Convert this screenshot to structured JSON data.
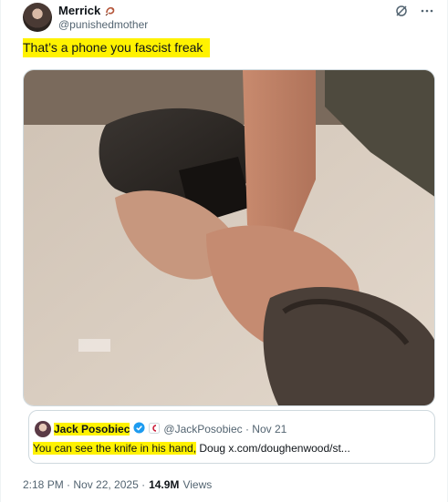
{
  "author": {
    "display_name": "Merrick",
    "handle": "@punishedmother",
    "name_emoji": "bird-emoji"
  },
  "actions": {
    "grok_icon": "grok-icon",
    "more_icon": "more-icon"
  },
  "tweet": {
    "text": "That’s a phone you fascist freak",
    "highlight_color": "#fff200"
  },
  "media": {
    "image": "photo of a hand gripping an arm on the floor near a boot and a phone"
  },
  "quoted": {
    "display_name": "Jack Posobiec",
    "handle_and_date": "@JackPosobiec · Nov 21",
    "text_highlighted": "You can see the knife in his hand,",
    "text_rest": " Doug x.com/doughenwood/st...",
    "verified_color": "#1d9bf0"
  },
  "footer": {
    "timestamp": "2:18 PM · Nov 22, 2025 ·",
    "views_count": "14.9M",
    "views_label": "Views"
  }
}
